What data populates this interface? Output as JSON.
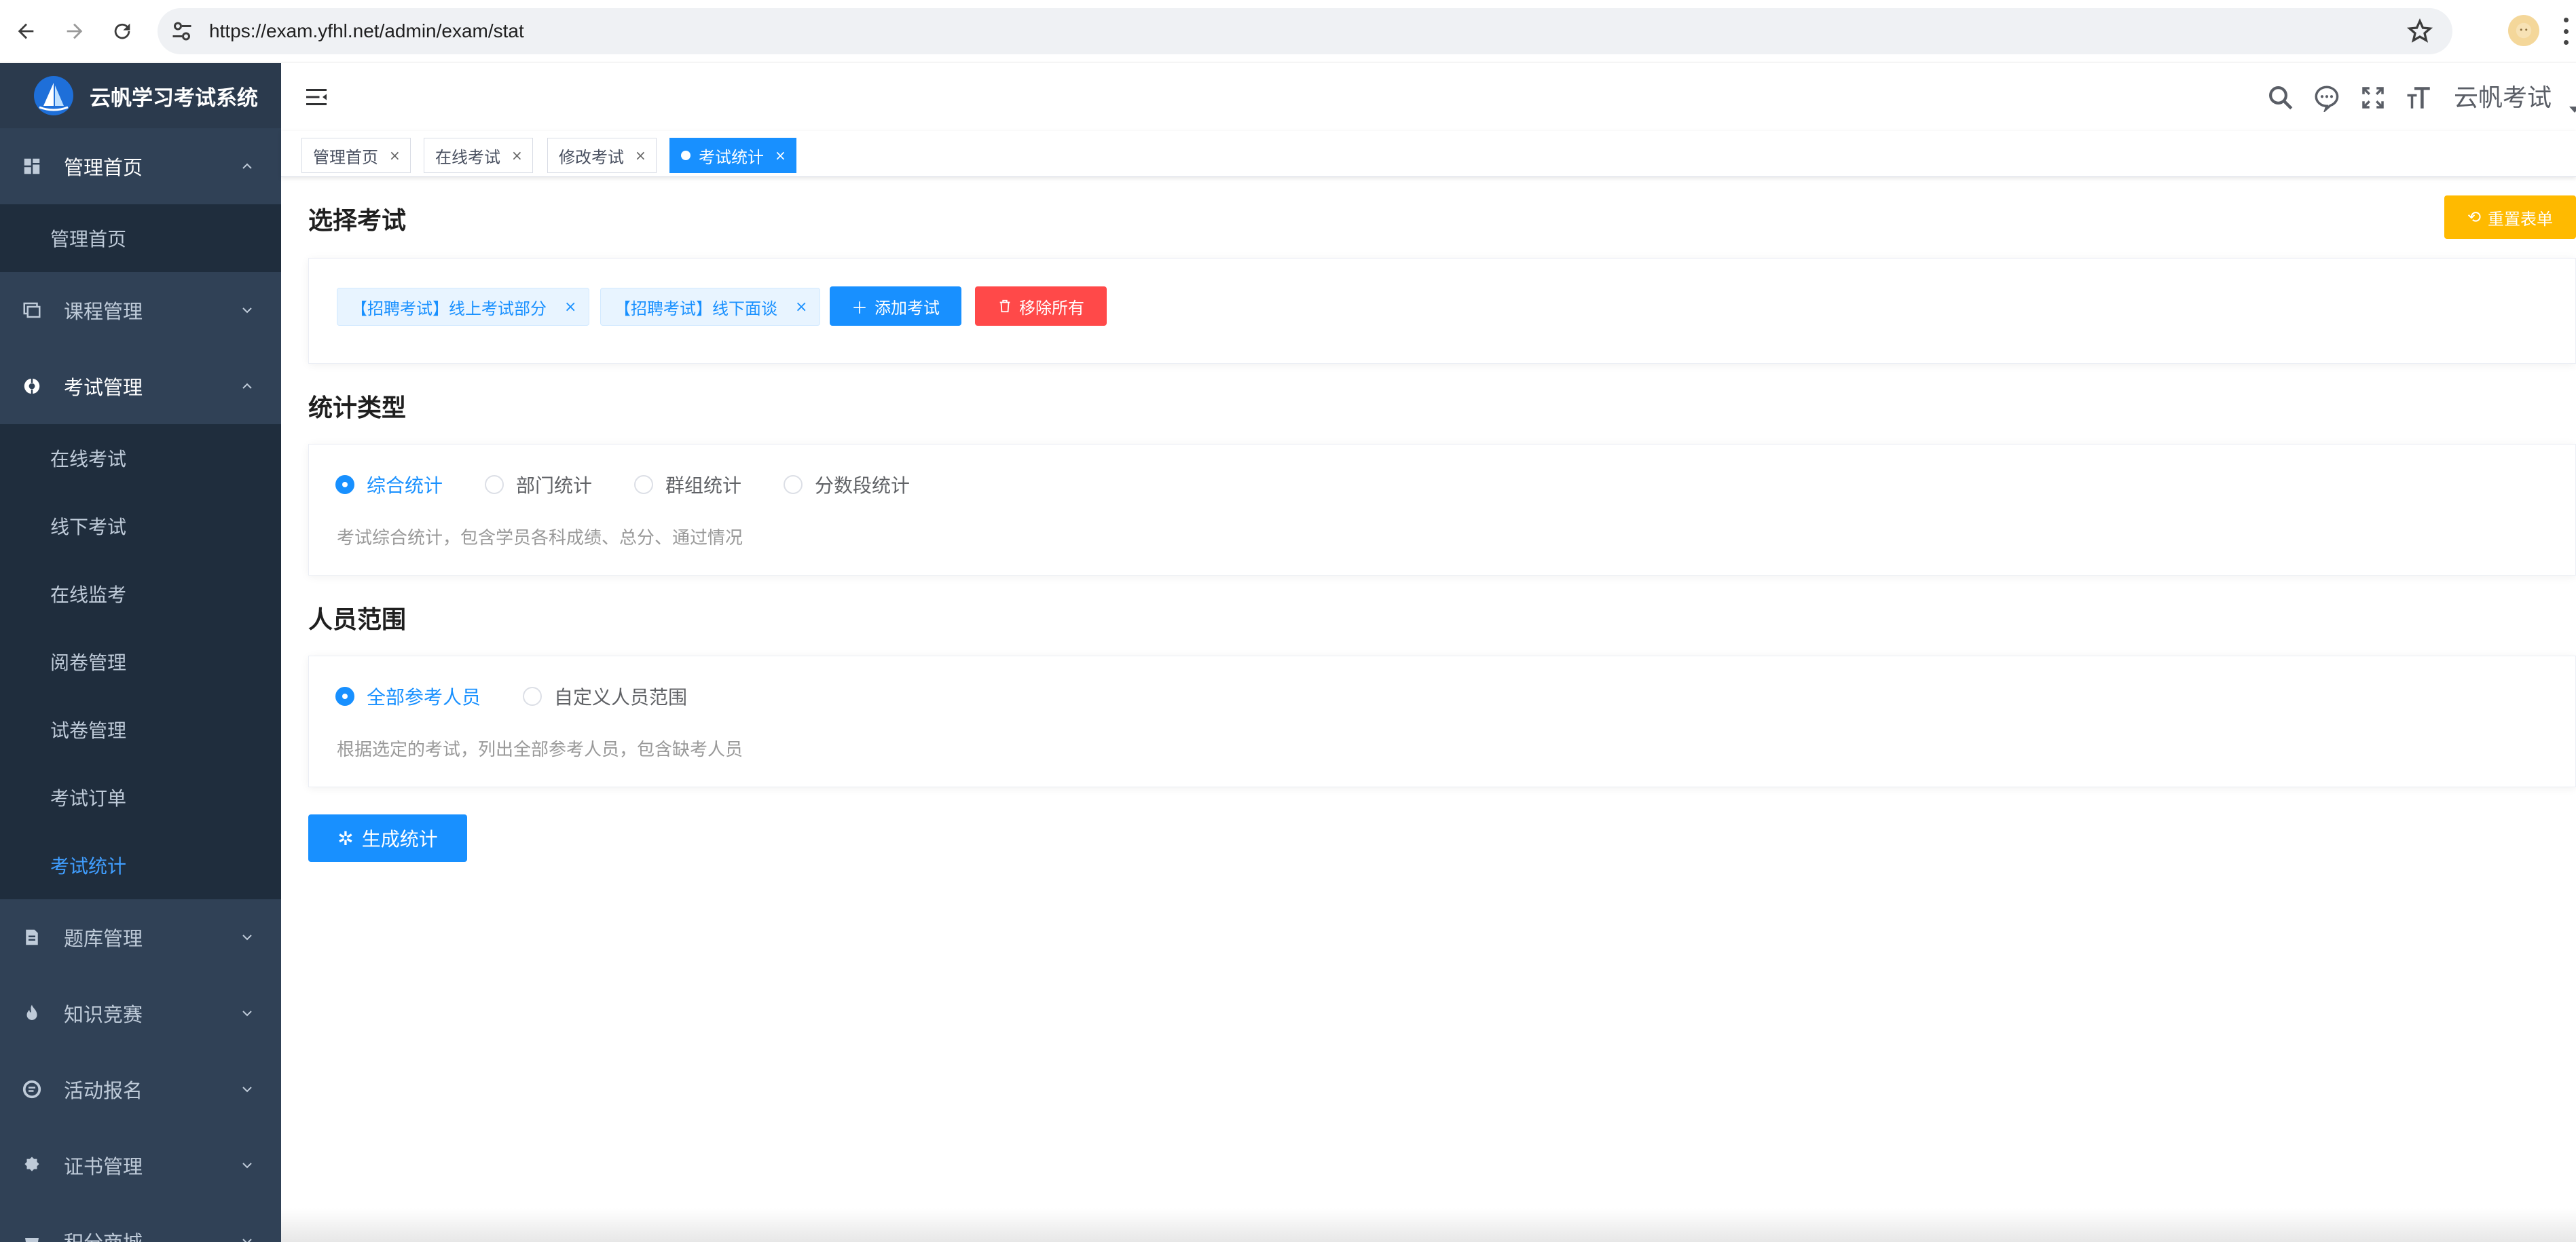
{
  "browser": {
    "url": "https://exam.yfhl.net/admin/exam/stat"
  },
  "sidebar": {
    "logo_text": "云帆学习考试系统",
    "groups": [
      {
        "label": "管理首页",
        "icon": "dashboard-icon",
        "open": true,
        "children": [
          {
            "label": "管理首页"
          }
        ]
      },
      {
        "label": "课程管理",
        "icon": "course-icon",
        "open": false,
        "children": []
      },
      {
        "label": "考试管理",
        "icon": "exam-icon",
        "open": true,
        "children": [
          {
            "label": "在线考试"
          },
          {
            "label": "线下考试"
          },
          {
            "label": "在线监考"
          },
          {
            "label": "阅卷管理"
          },
          {
            "label": "试卷管理"
          },
          {
            "label": "考试订单"
          },
          {
            "label": "考试统计",
            "active": true
          }
        ]
      },
      {
        "label": "题库管理",
        "icon": "question-bank-icon",
        "open": false,
        "children": []
      },
      {
        "label": "知识竞赛",
        "icon": "flame-icon",
        "open": false,
        "children": []
      },
      {
        "label": "活动报名",
        "icon": "activity-icon",
        "open": false,
        "children": []
      },
      {
        "label": "证书管理",
        "icon": "certificate-icon",
        "open": false,
        "children": []
      },
      {
        "label": "积分商城",
        "icon": "shop-icon",
        "open": false,
        "children": []
      }
    ]
  },
  "header": {
    "user_name": "云帆考试"
  },
  "tags": [
    {
      "label": "管理首页",
      "active": false
    },
    {
      "label": "在线考试",
      "active": false
    },
    {
      "label": "修改考试",
      "active": false
    },
    {
      "label": "考试统计",
      "active": true
    }
  ],
  "tag_close": "×",
  "select_exam": {
    "title": "选择考试",
    "reset_label": "重置表单",
    "exams": [
      "【招聘考试】线上考试部分",
      "【招聘考试】线下面谈"
    ],
    "add_label": "添加考试",
    "remove_all_label": "移除所有"
  },
  "stat_type": {
    "title": "统计类型",
    "options": [
      "综合统计",
      "部门统计",
      "群组统计",
      "分数段统计"
    ],
    "selected": "综合统计",
    "description": "考试综合统计，包含学员各科成绩、总分、通过情况"
  },
  "scope": {
    "title": "人员范围",
    "options": [
      "全部参考人员",
      "自定义人员范围"
    ],
    "selected": "全部参考人员",
    "description": "根据选定的考试，列出全部参考人员，包含缺考人员"
  },
  "generate_label": "生成统计",
  "colors": {
    "primary": "#1890ff",
    "sidebar_bg": "#304156",
    "submenu_bg": "#1f2d3d",
    "warning": "#ffba00",
    "danger": "#ff4949"
  }
}
